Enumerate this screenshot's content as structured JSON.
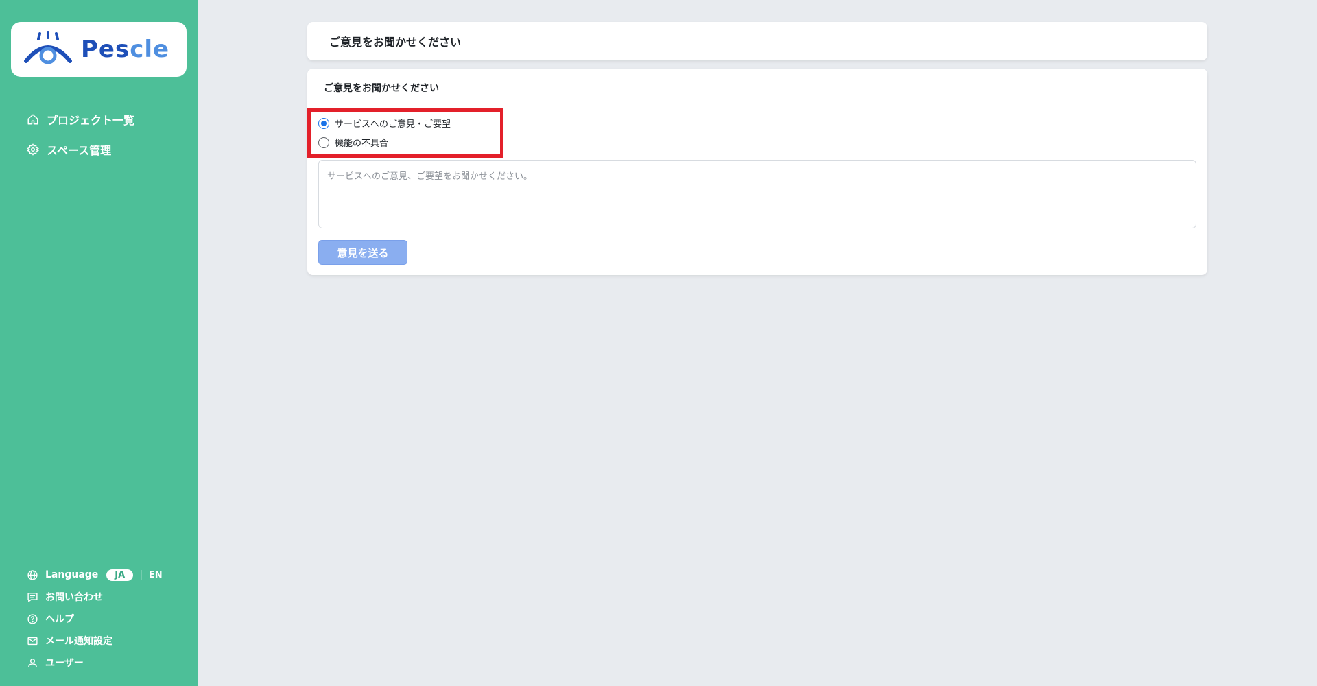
{
  "sidebar": {
    "logo_text": "Pescle",
    "nav": [
      {
        "label": "プロジェクト一覧",
        "icon": "home-icon"
      },
      {
        "label": "スペース管理",
        "icon": "gear-icon"
      }
    ],
    "footer": {
      "language_label": "Language",
      "lang_ja": "JA",
      "lang_sep": "|",
      "lang_en": "EN",
      "items": [
        {
          "label": "お問い合わせ",
          "icon": "chat-icon"
        },
        {
          "label": "ヘルプ",
          "icon": "help-icon"
        },
        {
          "label": "メール通知設定",
          "icon": "mail-icon"
        },
        {
          "label": "ユーザー",
          "icon": "user-icon"
        }
      ]
    }
  },
  "page": {
    "title": "ご意見をお聞かせください"
  },
  "form": {
    "heading": "ご意見をお聞かせください",
    "options": [
      {
        "label": "サービスへのご意見・ご要望",
        "checked": true
      },
      {
        "label": "機能の不具合",
        "checked": false
      }
    ],
    "textarea_placeholder": "サービスへのご意見、ご要望をお聞かせください。",
    "submit_label": "意見を送る"
  },
  "colors": {
    "sidebar_bg": "#4dbf98",
    "highlight": "#e3202a",
    "button_bg": "#8aaef0",
    "radio_checked": "#1a73e8"
  }
}
